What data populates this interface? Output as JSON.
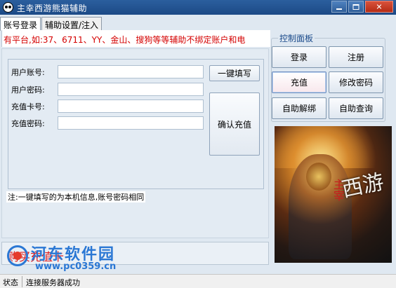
{
  "window": {
    "title": "主幸西游熊猫辅助",
    "buttons": [
      "minimize",
      "maximize",
      "close"
    ]
  },
  "tabs": [
    {
      "label": "账号登录",
      "active": true
    },
    {
      "label": "辅助设置/注入",
      "active": false
    }
  ],
  "ticker": "有平台,如:37、6711、YY、金山、搜狗等等辅助不绑定账户和电",
  "login_form": {
    "account_label": "用户账号:",
    "password_label": "用户密码:",
    "card_label": "充值卡号:",
    "card_password_label": "充值密码:",
    "account_value": "",
    "password_value": "",
    "card_value": "",
    "card_password_value": "",
    "autofill_button": "一键填写",
    "confirm_recharge_button": "确认充值",
    "note": "注:一键填写的为本机信息,账号密码相同"
  },
  "bottom": {
    "buy_card_link": "购买充值卡"
  },
  "control_panel": {
    "title": "控制面板",
    "buttons": [
      "登录",
      "注册",
      "充值",
      "修改密码",
      "自助解绑",
      "自助查询"
    ],
    "active": "充值"
  },
  "banner": {
    "calligraphy": "西游",
    "side_text": "主宰"
  },
  "watermark": {
    "title": "河东软件园",
    "url": "www.pc0359.cn"
  },
  "status": {
    "label": "状态",
    "message": "连接服务器成功"
  }
}
